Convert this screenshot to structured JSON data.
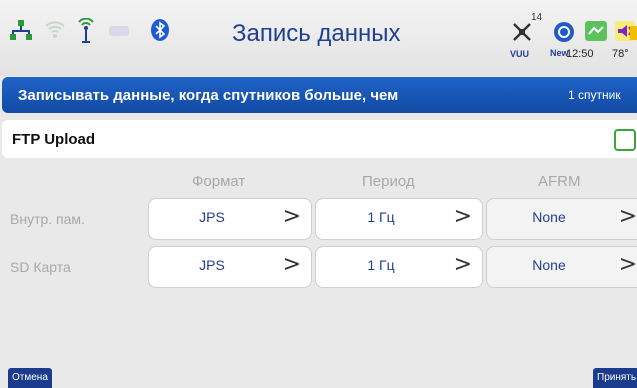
{
  "statusbar": {
    "title": "Запись данных",
    "sat_count": "14",
    "sat_label": "VUU",
    "new_label": "New",
    "time": "12:50",
    "temp": "78°"
  },
  "condition": {
    "label": "Записывать данные, когда спутников больше, чем",
    "value": "1 спутник"
  },
  "ftp": {
    "label": "FTP Upload",
    "checked": false
  },
  "table": {
    "headers": [
      "Формат",
      "Период",
      "AFRM"
    ],
    "rows": [
      {
        "label": "Внутр. пам.",
        "format": "JPS",
        "period": "1 Гц",
        "afrm": "None"
      },
      {
        "label": "SD Карта",
        "format": "JPS",
        "period": "1 Гц",
        "afrm": "None"
      }
    ],
    "chevron": ">"
  },
  "buttons": {
    "cancel": "Отмена",
    "accept": "Принять"
  },
  "colors": {
    "accent_blue": "#1f63c8",
    "title_blue": "#1f3f8f",
    "checkbox_green": "#3aa53a",
    "button_navy": "#1b3b8c"
  }
}
